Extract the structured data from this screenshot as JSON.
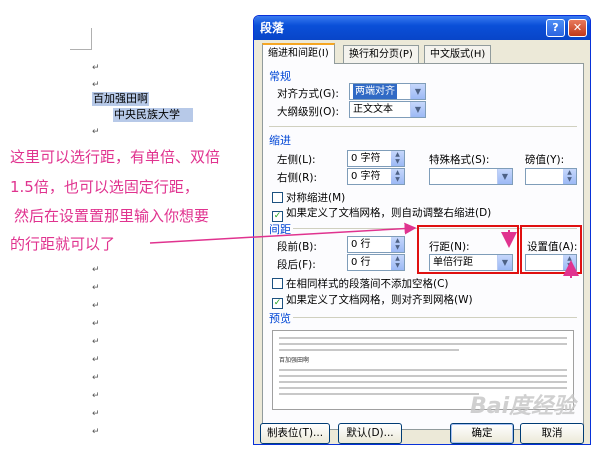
{
  "document": {
    "selected_line_1": "百加强田啊",
    "selected_line_2": "中央民族大学",
    "para_mark": "↵"
  },
  "annotation": {
    "line1": "这里可以选行距，有单倍、双倍",
    "line2": "1.5倍，也可以选固定行距，",
    "line3": "然后在设置置那里输入你想要",
    "line4": "的行距就可以了",
    "color": "#e0338f"
  },
  "dialog": {
    "title": "段落",
    "help_icon": "?",
    "close_icon": "✕",
    "tabs": [
      {
        "label": "缩进和间距(I)",
        "active": true
      },
      {
        "label": "换行和分页(P)",
        "active": false
      },
      {
        "label": "中文版式(H)",
        "active": false
      }
    ],
    "general": {
      "title": "常规",
      "alignment_label": "对齐方式(G):",
      "alignment_value": "两端对齐",
      "outline_label": "大纲级别(O):",
      "outline_value": "正文文本"
    },
    "indent": {
      "title": "缩进",
      "left_label": "左侧(L):",
      "left_value": "0 字符",
      "right_label": "右侧(R):",
      "right_value": "0 字符",
      "special_label": "特殊格式(S):",
      "special_value": "",
      "by_label": "磅值(Y):",
      "by_value": "",
      "mirror_label": "对称缩进(M)",
      "mirror_checked": false,
      "auto_adjust_label": "如果定义了文档网格，则自动调整右缩进(D)",
      "auto_adjust_checked": true
    },
    "spacing": {
      "title": "间距",
      "before_label": "段前(B):",
      "before_value": "0 行",
      "after_label": "段后(F):",
      "after_value": "0 行",
      "line_spacing_label": "行距(N):",
      "line_spacing_value": "单倍行距",
      "at_label": "设置值(A):",
      "at_value": "",
      "no_space_label": "在相同样式的段落间不添加空格(C)",
      "no_space_checked": false,
      "snap_grid_label": "如果定义了文档网格，则对齐到网格(W)",
      "snap_grid_checked": true
    },
    "preview": {
      "title": "预览",
      "sample_text": "百加强田啊"
    },
    "buttons": {
      "tabs": "制表位(T)...",
      "default": "默认(D)...",
      "ok": "确定",
      "cancel": "取消"
    }
  },
  "watermark": "Bai度经验"
}
